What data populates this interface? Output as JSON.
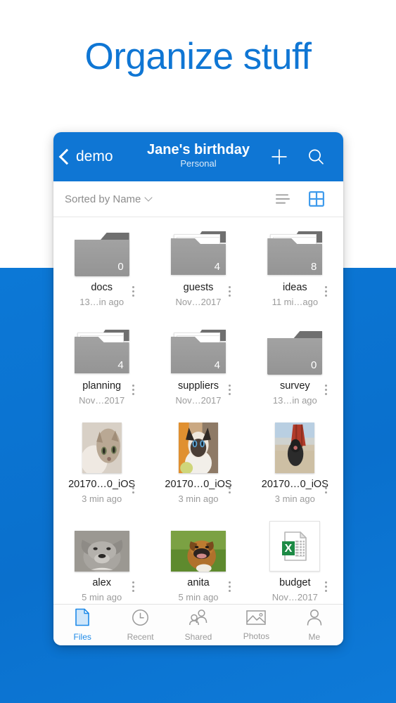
{
  "hero": {
    "title": "Organize stuff",
    "title_color": "#0f76d4"
  },
  "theme": {
    "brand_blue": "#0f76d4",
    "background_blue": "#0a72d0",
    "accent_blue": "#1e8ae8",
    "folder_gray": "#9a9a9a",
    "excel_green": "#1d8a45"
  },
  "app_header": {
    "back_label": "demo",
    "back_icon": "chevron-left-icon",
    "title": "Jane's birthday",
    "subtitle": "Personal",
    "add_icon": "plus-icon",
    "search_icon": "search-icon"
  },
  "sort_bar": {
    "sort_label": "Sorted by Name",
    "chevron_icon": "chevron-down-icon",
    "list_view_icon": "list-view-icon",
    "grid_view_icon": "grid-view-icon",
    "active_view": "grid"
  },
  "file_grid": {
    "rows": [
      [
        {
          "type": "folder",
          "name": "docs",
          "date": "13…in ago",
          "count": "0",
          "empty": true
        },
        {
          "type": "folder",
          "name": "guests",
          "date": "Nov…2017",
          "count": "4",
          "empty": false
        },
        {
          "type": "folder",
          "name": "ideas",
          "date": "11 mi…ago",
          "count": "8",
          "empty": false
        }
      ],
      [
        {
          "type": "folder",
          "name": "planning",
          "date": "Nov…2017",
          "count": "4",
          "empty": false
        },
        {
          "type": "folder",
          "name": "suppliers",
          "date": "Nov…2017",
          "count": "4",
          "empty": false
        },
        {
          "type": "folder",
          "name": "survey",
          "date": "13…in ago",
          "count": "0",
          "empty": true
        }
      ],
      [
        {
          "type": "photo",
          "name": "20170…0_iOS",
          "date": "3 min ago",
          "image": "kitten-tabby-photo"
        },
        {
          "type": "photo",
          "name": "20170…0_iOS",
          "date": "3 min ago",
          "image": "kitten-siamese-photo"
        },
        {
          "type": "photo",
          "name": "20170…0_iOS",
          "date": "3 min ago",
          "image": "dog-swing-photo"
        }
      ],
      [
        {
          "type": "photo-wide",
          "name": "alex",
          "date": "5 min ago",
          "image": "dog-grey-photo"
        },
        {
          "type": "photo-wide",
          "name": "anita",
          "date": "5 min ago",
          "image": "dog-boxer-photo"
        },
        {
          "type": "excel",
          "name": "budget",
          "date": "Nov…2017",
          "image": "excel-file-icon"
        }
      ]
    ],
    "overflow_icon": "kebab-menu-icon"
  },
  "tab_bar": {
    "tabs": [
      {
        "label": "Files",
        "icon": "document-icon",
        "active": true
      },
      {
        "label": "Recent",
        "icon": "clock-icon",
        "active": false
      },
      {
        "label": "Shared",
        "icon": "people-icon",
        "active": false
      },
      {
        "label": "Photos",
        "icon": "photo-landscape-icon",
        "active": false
      },
      {
        "label": "Me",
        "icon": "person-icon",
        "active": false
      }
    ]
  }
}
